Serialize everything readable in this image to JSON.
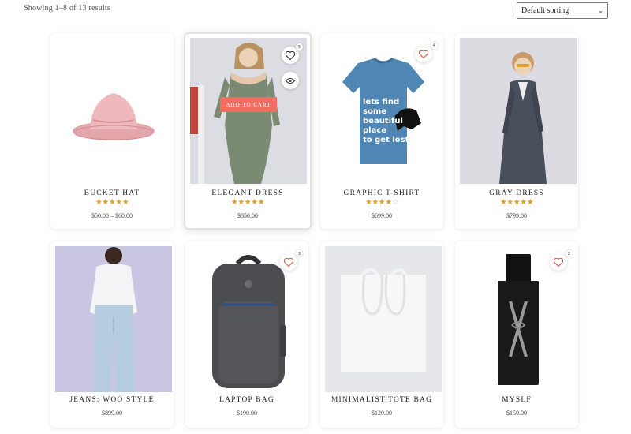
{
  "results": {
    "text": "Showing 1–8 of 13 results"
  },
  "sorting": {
    "selected": "Default sorting"
  },
  "colors": {
    "accent": "#f26d5f",
    "star": "#e39b2a",
    "heart": "#e2574c"
  },
  "products": [
    {
      "name": "BUCKET HAT",
      "rating": 5,
      "price": "$50.00 – $60.00",
      "icon": "bucket-hat-image"
    },
    {
      "name": "ELEGANT DRESS",
      "rating": 5,
      "price": "$850.00",
      "icon": "elegant-dress-image",
      "wishlist_count": "5",
      "add_to_cart": "ADD TO CART"
    },
    {
      "name": "GRAPHIC T-SHIRT",
      "rating": 4,
      "price": "$699.00",
      "icon": "graphic-tshirt-image",
      "wishlist_count": "4",
      "shirt_text": [
        "lets find",
        "some",
        "beautiful",
        "place",
        "to get lost"
      ]
    },
    {
      "name": "GRAY DRESS",
      "rating": 5,
      "price": "$799.00",
      "icon": "gray-dress-image"
    },
    {
      "name": "JEANS: WOO STYLE",
      "price": "$899.00",
      "icon": "jeans-image"
    },
    {
      "name": "LAPTOP BAG",
      "price": "$190.00",
      "icon": "laptop-bag-image",
      "wishlist_count": "3"
    },
    {
      "name": "MINIMALIST TOTE BAG",
      "price": "$120.00",
      "icon": "tote-bag-image"
    },
    {
      "name": "MYSLF",
      "price": "$150.00",
      "icon": "perfume-image",
      "wishlist_count": "2"
    }
  ]
}
